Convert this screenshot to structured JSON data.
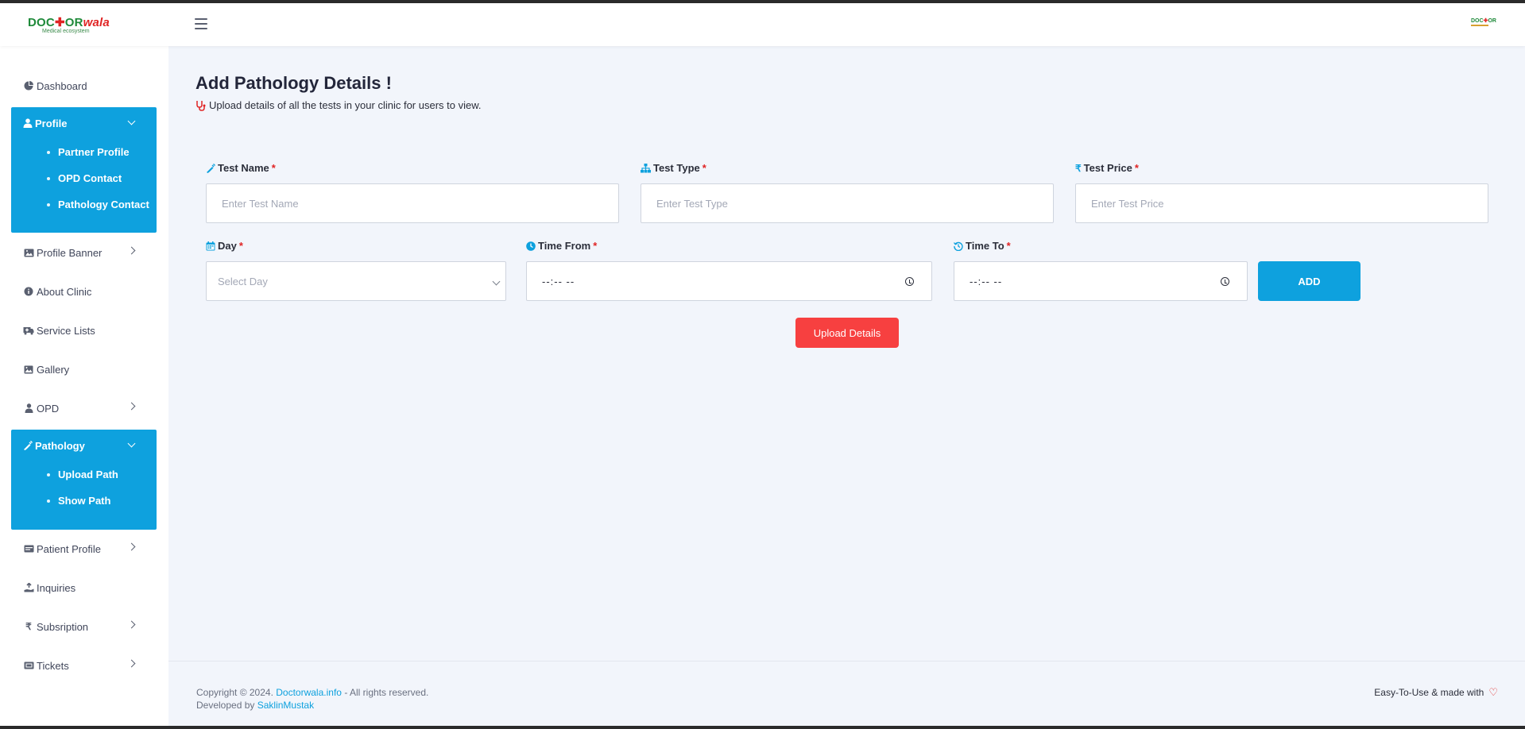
{
  "header": {
    "logo": {
      "part1": "DOC",
      "part2": "OR",
      "part3": "wala",
      "tagline": "Medical ecosystem"
    },
    "mini_logo": {
      "part1": "DOC",
      "part2": "OR"
    }
  },
  "sidebar": {
    "dashboard": "Dashboard",
    "profile": {
      "label": "Profile",
      "items": [
        "Partner Profile",
        "OPD Contact",
        "Pathology Contact"
      ]
    },
    "profile_banner": "Profile Banner",
    "about_clinic": "About Clinic",
    "service_lists": "Service Lists",
    "gallery": "Gallery",
    "opd": "OPD",
    "pathology": {
      "label": "Pathology",
      "items": [
        "Upload Path",
        "Show Path"
      ]
    },
    "patient_profile": "Patient Profile",
    "inquiries": "Inquiries",
    "subscription": "Subsription",
    "tickets": "Tickets"
  },
  "main": {
    "title": "Add Pathology Details !",
    "subtitle": "Upload details of all the tests in your clinic for users to view.",
    "fields": {
      "test_name": {
        "label": "Test Name",
        "placeholder": "Enter Test Name"
      },
      "test_type": {
        "label": "Test Type",
        "placeholder": "Enter Test Type"
      },
      "test_price": {
        "label": "Test Price",
        "placeholder": "Enter Test Price"
      },
      "day": {
        "label": "Day",
        "value": "Select Day"
      },
      "time_from": {
        "label": "Time From",
        "value": "--:-- --"
      },
      "time_to": {
        "label": "Time To",
        "value": "--:-- --"
      }
    },
    "required_mark": "*",
    "add_button": "ADD",
    "upload_button": "Upload Details"
  },
  "footer": {
    "copyright": "Copyright © 2024.",
    "site_link": "Doctorwala.info",
    "rights": "- All rights reserved.",
    "developed_by": "Developed by",
    "developer_link": "SaklinMustak",
    "tagline": "Easy-To-Use & made with"
  },
  "colors": {
    "accent": "#0ea1de",
    "danger": "#f74040",
    "background": "#f2f5fb"
  }
}
